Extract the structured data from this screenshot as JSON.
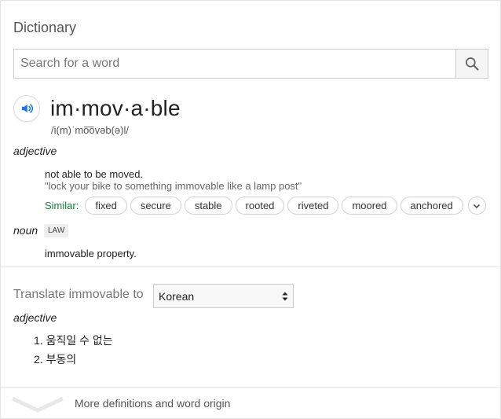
{
  "title": "Dictionary",
  "search": {
    "placeholder": "Search for a word"
  },
  "entry": {
    "headword": "im·mov·a·ble",
    "phonetic": "/i(m)ˈmo͞ovəb(ə)l/",
    "adjective": {
      "pos": "adjective",
      "definition": "not able to be moved.",
      "example": "\"lock your bike to something immovable like a lamp post\"",
      "similar_label": "Similar:",
      "similar": [
        "fixed",
        "secure",
        "stable",
        "rooted",
        "riveted",
        "moored",
        "anchored"
      ]
    },
    "noun": {
      "pos": "noun",
      "tag": "LAW",
      "definition": "immovable property."
    }
  },
  "translate": {
    "label": "Translate immovable to",
    "language": "Korean",
    "pos": "adjective",
    "items": [
      "1. 움직일 수 없는",
      "2. 부동의"
    ]
  },
  "more": {
    "label": "More definitions and word origin"
  },
  "colors": {
    "similar_label": "#188038",
    "speaker_icon": "#1a73e8"
  }
}
